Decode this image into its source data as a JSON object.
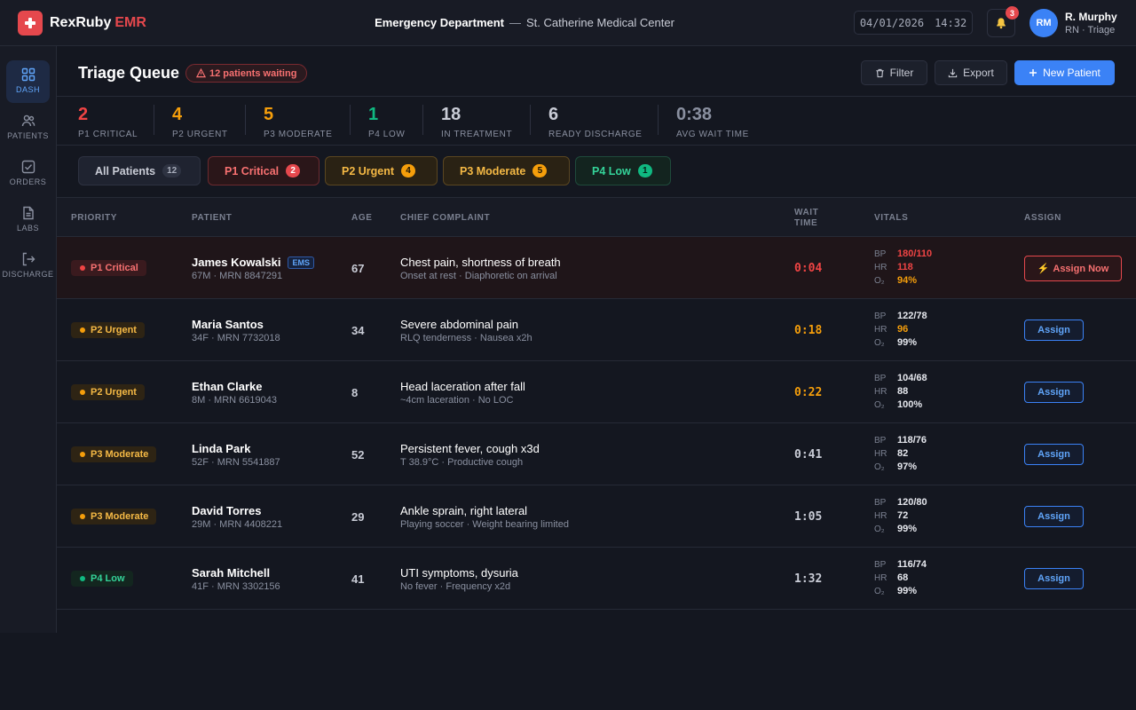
{
  "brand": {
    "name": "RexRuby",
    "accent": "EMR"
  },
  "header": {
    "department": "Emergency Department",
    "separator": "—",
    "facility": "St. Catherine Medical Center",
    "date": "04/01/2026",
    "time": "14:32",
    "notifications": "3",
    "user": {
      "initials": "RM",
      "name": "R. Murphy",
      "role": "RN · Triage"
    }
  },
  "sidebar": {
    "items": [
      {
        "label": "DASH",
        "icon": "grid-icon"
      },
      {
        "label": "PATIENTS",
        "icon": "users-icon"
      },
      {
        "label": "ORDERS",
        "icon": "checklist-icon"
      },
      {
        "label": "LABS",
        "icon": "document-icon"
      },
      {
        "label": "DISCHARGE",
        "icon": "exit-icon"
      }
    ]
  },
  "page": {
    "title": "Triage Queue",
    "waiting": "12 patients waiting",
    "filter_label": "Filter",
    "export_label": "Export",
    "new_label": "New Patient"
  },
  "stats": [
    {
      "value": "2",
      "label": "P1 CRITICAL",
      "color": "#ef4444"
    },
    {
      "value": "4",
      "label": "P2 URGENT",
      "color": "#f59e0b"
    },
    {
      "value": "5",
      "label": "P3 MODERATE",
      "color": "#f59e0b"
    },
    {
      "value": "1",
      "label": "P4 LOW",
      "color": "#10b981"
    },
    {
      "value": "18",
      "label": "IN TREATMENT",
      "color": "#c9ccd6"
    },
    {
      "value": "6",
      "label": "READY DISCHARGE",
      "color": "#c9ccd6"
    },
    {
      "value": "0:38",
      "label": "AVG WAIT TIME",
      "color": "#8a90a0"
    }
  ],
  "filters": [
    {
      "label": "All Patients",
      "count": "12"
    },
    {
      "label": "P1 Critical",
      "count": "2"
    },
    {
      "label": "P2 Urgent",
      "count": "4"
    },
    {
      "label": "P3 Moderate",
      "count": "5"
    },
    {
      "label": "P4 Low",
      "count": "1"
    }
  ],
  "columns": {
    "priority": "PRIORITY",
    "patient": "PATIENT",
    "age": "AGE",
    "complaint": "CHIEF COMPLAINT",
    "wait_line1": "WAIT",
    "wait_line2": "TIME",
    "vitals": "VITALS",
    "assign": "ASSIGN"
  },
  "vital_labels": {
    "bp": "BP",
    "hr": "HR",
    "o2": "O₂"
  },
  "patients": [
    {
      "priority": "P1 Critical",
      "name": "James Kowalski",
      "tag": "EMS",
      "meta": "67M · MRN 8847291",
      "age": "67",
      "complaint": "Chest pain, shortness of breath",
      "detail": "Onset at rest · Diaphoretic on arrival",
      "wait": "0:04",
      "bp": "180/110",
      "hr": "118",
      "o2": "94%",
      "assign": "Assign Now"
    },
    {
      "priority": "P2 Urgent",
      "name": "Maria Santos",
      "meta": "34F · MRN 7732018",
      "age": "34",
      "complaint": "Severe abdominal pain",
      "detail": "RLQ tenderness · Nausea x2h",
      "wait": "0:18",
      "bp": "122/78",
      "hr": "96",
      "o2": "99%",
      "assign": "Assign"
    },
    {
      "priority": "P2 Urgent",
      "name": "Ethan Clarke",
      "meta": "8M · MRN 6619043",
      "age": "8",
      "complaint": "Head laceration after fall",
      "detail": "~4cm laceration · No LOC",
      "wait": "0:22",
      "bp": "104/68",
      "hr": "88",
      "o2": "100%",
      "assign": "Assign"
    },
    {
      "priority": "P3 Moderate",
      "name": "Linda Park",
      "meta": "52F · MRN 5541887",
      "age": "52",
      "complaint": "Persistent fever, cough x3d",
      "detail": "T 38.9°C · Productive cough",
      "wait": "0:41",
      "bp": "118/76",
      "hr": "82",
      "o2": "97%",
      "assign": "Assign"
    },
    {
      "priority": "P3 Moderate",
      "name": "David Torres",
      "meta": "29M · MRN 4408221",
      "age": "29",
      "complaint": "Ankle sprain, right lateral",
      "detail": "Playing soccer · Weight bearing limited",
      "wait": "1:05",
      "bp": "120/80",
      "hr": "72",
      "o2": "99%",
      "assign": "Assign"
    },
    {
      "priority": "P4 Low",
      "name": "Sarah Mitchell",
      "meta": "41F · MRN 3302156",
      "age": "41",
      "complaint": "UTI symptoms, dysuria",
      "detail": "No fever · Frequency x2d",
      "wait": "1:32",
      "bp": "116/74",
      "hr": "68",
      "o2": "99%",
      "assign": "Assign"
    }
  ],
  "colors": {
    "critical": "#ef4444",
    "urgent": "#f59e0b",
    "low": "#10b981",
    "accent": "#3b82f6"
  }
}
